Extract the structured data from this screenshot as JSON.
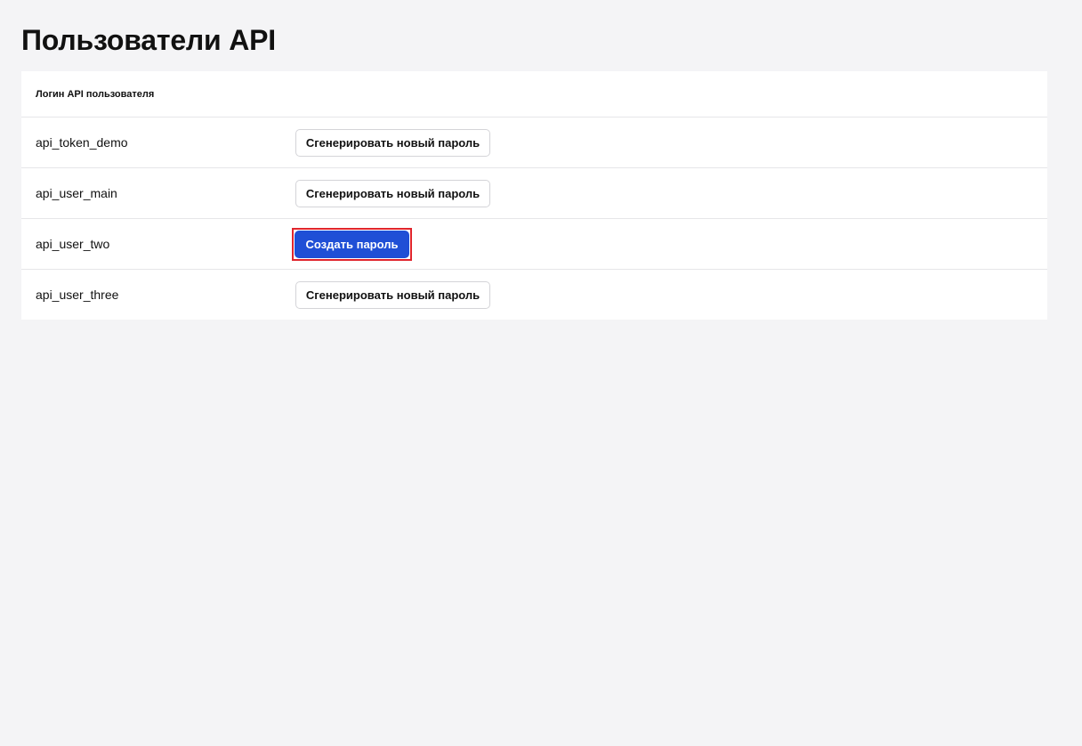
{
  "page": {
    "title": "Пользователи API"
  },
  "table": {
    "columns": [
      "Логин API пользователя"
    ],
    "rows": [
      {
        "login": "api_token_demo",
        "action": "Сгенерировать новый пароль",
        "action_type": "regenerate"
      },
      {
        "login": "api_user_main",
        "action": "Сгенерировать новый пароль",
        "action_type": "regenerate"
      },
      {
        "login": "api_user_two",
        "action": "Создать пароль",
        "action_type": "create",
        "highlighted": true
      },
      {
        "login": "api_user_three",
        "action": "Сгенерировать новый пароль",
        "action_type": "regenerate"
      }
    ]
  },
  "colors": {
    "background": "#f4f4f6",
    "primary": "#1f4fd6",
    "highlight": "#e0252d"
  }
}
